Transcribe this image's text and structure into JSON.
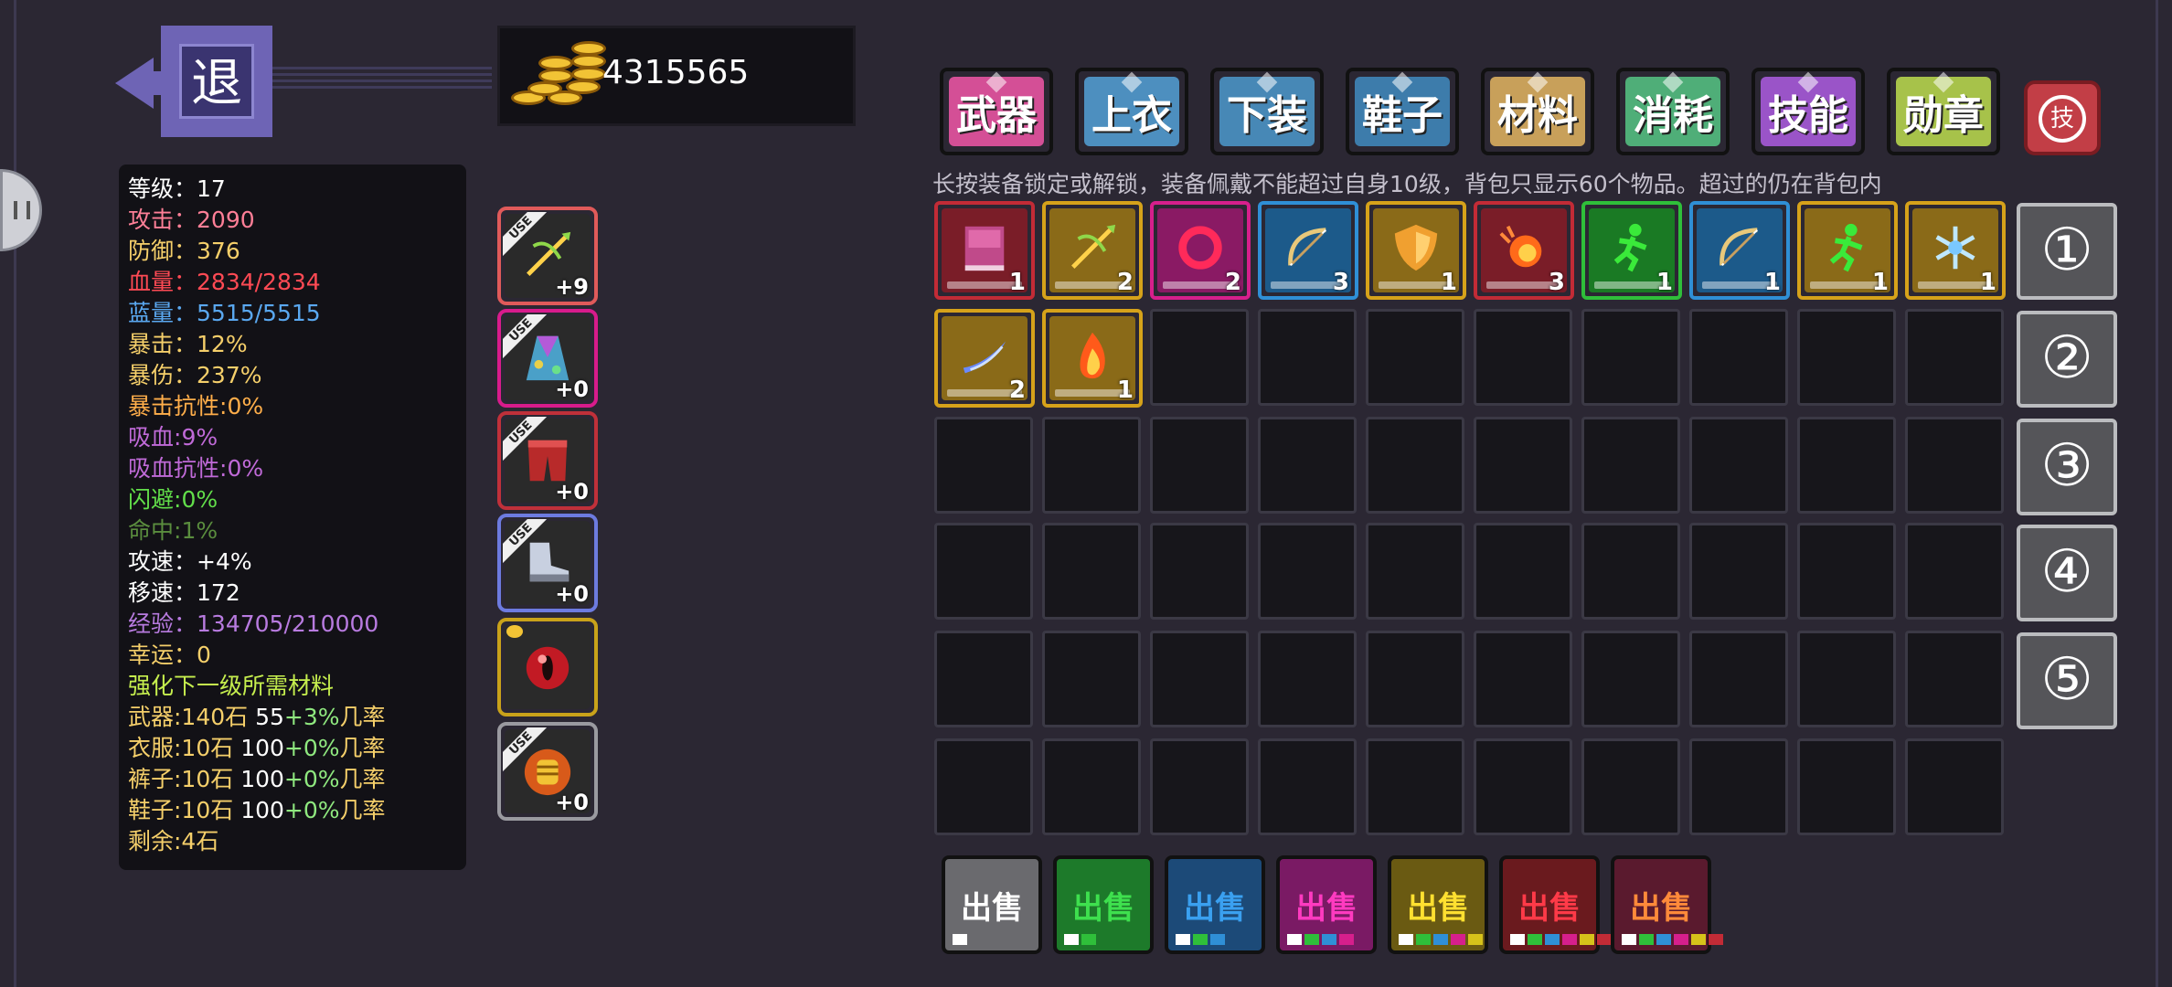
{
  "back_button": {
    "label": "退"
  },
  "gold": {
    "amount": "4315565"
  },
  "stats": [
    {
      "label": "等级：",
      "value": "17",
      "label_color": "#ffffff",
      "value_color": "#ffffff"
    },
    {
      "label": "攻击：",
      "value": "2090",
      "label_color": "#ff7f97",
      "value_color": "#ff7f97"
    },
    {
      "label": "防御：",
      "value": "376",
      "label_color": "#f5cf6a",
      "value_color": "#f5cf6a"
    },
    {
      "label": "血量：",
      "value": "2834/2834",
      "label_color": "#ff4a54",
      "value_color": "#ff4a54"
    },
    {
      "label": "蓝量：",
      "value": "5515/5515",
      "label_color": "#5aa8f0",
      "value_color": "#5aa8f0"
    },
    {
      "label": "暴击：",
      "value": "12%",
      "label_color": "#f5cf6a",
      "value_color": "#f5cf6a"
    },
    {
      "label": "暴伤：",
      "value": "237%",
      "label_color": "#f5cf6a",
      "value_color": "#f5cf6a"
    },
    {
      "label": "暴击抗性:",
      "value": "0%",
      "label_color": "#ffae4a",
      "value_color": "#ffae4a"
    },
    {
      "label": "吸血:",
      "value": "9%",
      "label_color": "#c06ad8",
      "value_color": "#c06ad8"
    },
    {
      "label": "吸血抗性:",
      "value": "0%",
      "label_color": "#c06ad8",
      "value_color": "#c06ad8"
    },
    {
      "label": "闪避:",
      "value": "0%",
      "label_color": "#62df4a",
      "value_color": "#62df4a"
    },
    {
      "label": "命中:",
      "value": "1%",
      "label_color": "#5a8d3e",
      "value_color": "#5a8d3e"
    },
    {
      "label": "攻速：",
      "value": "+4%",
      "label_color": "#ffffff",
      "value_color": "#ffffff"
    },
    {
      "label": "移速：",
      "value": "172",
      "label_color": "#ffffff",
      "value_color": "#ffffff"
    },
    {
      "label": "经验：",
      "value": "134705/210000",
      "label_color": "#b87be0",
      "value_color": "#b87be0"
    },
    {
      "label": "幸运：",
      "value": "0",
      "label_color": "#f5cf6a",
      "value_color": "#f5cf6a"
    }
  ],
  "upgrade": {
    "title": "强化下一级所需材料",
    "rows": [
      {
        "name": "武器:140石 ",
        "base": "55",
        "bonus": "+3%",
        "suffix": "几率"
      },
      {
        "name": "衣服:10石 ",
        "base": "100",
        "bonus": "+0%",
        "suffix": "几率"
      },
      {
        "name": "裤子:10石 ",
        "base": "100",
        "bonus": "+0%",
        "suffix": "几率"
      },
      {
        "name": "鞋子:10石 ",
        "base": "100",
        "bonus": "+0%",
        "suffix": "几率"
      }
    ],
    "remaining": "剩余:4石"
  },
  "equipped": [
    {
      "slot": "weapon",
      "badge": "USE",
      "plus": "+9",
      "icon": "crossbow-icon",
      "frame_color": "#e05a5a"
    },
    {
      "slot": "armor",
      "badge": "USE",
      "plus": "+0",
      "icon": "robe-icon",
      "frame_color": "#d81b8c"
    },
    {
      "slot": "pants",
      "badge": "USE",
      "plus": "+0",
      "icon": "red-pants-icon",
      "frame_color": "#c0303a"
    },
    {
      "slot": "shoes",
      "badge": "USE",
      "plus": "+0",
      "icon": "boots-icon",
      "frame_color": "#6d7be0"
    },
    {
      "slot": "pet",
      "badge": "",
      "plus": "",
      "icon": "red-eye-orb-icon",
      "frame_color": "#c9a21a"
    },
    {
      "slot": "medal",
      "badge": "USE",
      "plus": "+0",
      "icon": "fist-medal-icon",
      "frame_color": "#9a9aa0"
    }
  ],
  "tabs": [
    {
      "label": "武器",
      "color": "#d44f96"
    },
    {
      "label": "上衣",
      "color": "#4d8fbf"
    },
    {
      "label": "下装",
      "color": "#4788b6"
    },
    {
      "label": "鞋子",
      "color": "#3d7cab"
    },
    {
      "label": "材料",
      "color": "#c8a05a"
    },
    {
      "label": "消耗",
      "color": "#4fae78"
    },
    {
      "label": "技能",
      "color": "#9a54c8"
    },
    {
      "label": "勋章",
      "color": "#a7c24a"
    }
  ],
  "skill_button": {
    "label": "技"
  },
  "hint": "长按装备锁定或解锁，装备佩戴不能超过自身10级，背包只显示60个物品。超过的仍在背包内",
  "inventory": [
    {
      "count": "1",
      "icon": "spellbook-icon",
      "frame": "#c22b36",
      "bg": "#7a1d28"
    },
    {
      "count": "2",
      "icon": "crossbow-icon",
      "frame": "#d6a21a",
      "bg": "#8a6a18"
    },
    {
      "count": "2",
      "icon": "ring-icon",
      "frame": "#d61f8c",
      "bg": "#8a1a64"
    },
    {
      "count": "3",
      "icon": "bow-icon",
      "frame": "#2f8fd6",
      "bg": "#1c5a8a"
    },
    {
      "count": "1",
      "icon": "shield-icon",
      "frame": "#d6a21a",
      "bg": "#8a6a18"
    },
    {
      "count": "3",
      "icon": "fireball-icon",
      "frame": "#c22b36",
      "bg": "#7a1d28"
    },
    {
      "count": "1",
      "icon": "runner-icon",
      "frame": "#2fbf3a",
      "bg": "#1a7a24"
    },
    {
      "count": "1",
      "icon": "bow-icon",
      "frame": "#2f8fd6",
      "bg": "#1c5a8a"
    },
    {
      "count": "1",
      "icon": "runner-icon",
      "frame": "#d6a21a",
      "bg": "#8a6a18"
    },
    {
      "count": "1",
      "icon": "snowflake-icon",
      "frame": "#d6a21a",
      "bg": "#8a6a18"
    },
    {
      "count": "2",
      "icon": "slash-icon",
      "frame": "#d6a21a",
      "bg": "#8a6a18"
    },
    {
      "count": "1",
      "icon": "fire-icon",
      "frame": "#d6a21a",
      "bg": "#8a6a18"
    }
  ],
  "pages": [
    "①",
    "②",
    "③",
    "④",
    "⑤"
  ],
  "sell_buttons": [
    {
      "label": "出售",
      "bg": "#6a6a6e",
      "text": "#ffffff",
      "dots": [
        "#ffffff"
      ]
    },
    {
      "label": "出售",
      "bg": "#1d7a2a",
      "text": "#3ee04e",
      "dots": [
        "#ffffff",
        "#2fbf3a"
      ]
    },
    {
      "label": "出售",
      "bg": "#1c4a78",
      "text": "#3aa0f0",
      "dots": [
        "#ffffff",
        "#2fbf3a",
        "#2f8fd6"
      ]
    },
    {
      "label": "出售",
      "bg": "#7a1a64",
      "text": "#ff3ac0",
      "dots": [
        "#ffffff",
        "#2fbf3a",
        "#2f8fd6",
        "#d61f8c"
      ]
    },
    {
      "label": "出售",
      "bg": "#6a5a12",
      "text": "#ffe030",
      "dots": [
        "#ffffff",
        "#2fbf3a",
        "#2f8fd6",
        "#d61f8c",
        "#d6c21a"
      ]
    },
    {
      "label": "出售",
      "bg": "#6a1a1e",
      "text": "#ff3a48",
      "dots": [
        "#ffffff",
        "#2fbf3a",
        "#2f8fd6",
        "#d61f8c",
        "#d6c21a",
        "#c22b36"
      ]
    },
    {
      "label": "出售",
      "bg": "#5a1a2e",
      "text": "#ff8a3a",
      "dots": [
        "#ffffff",
        "#2fbf3a",
        "#2f8fd6",
        "#d61f8c",
        "#d6c21a",
        "#c22b36"
      ]
    }
  ]
}
